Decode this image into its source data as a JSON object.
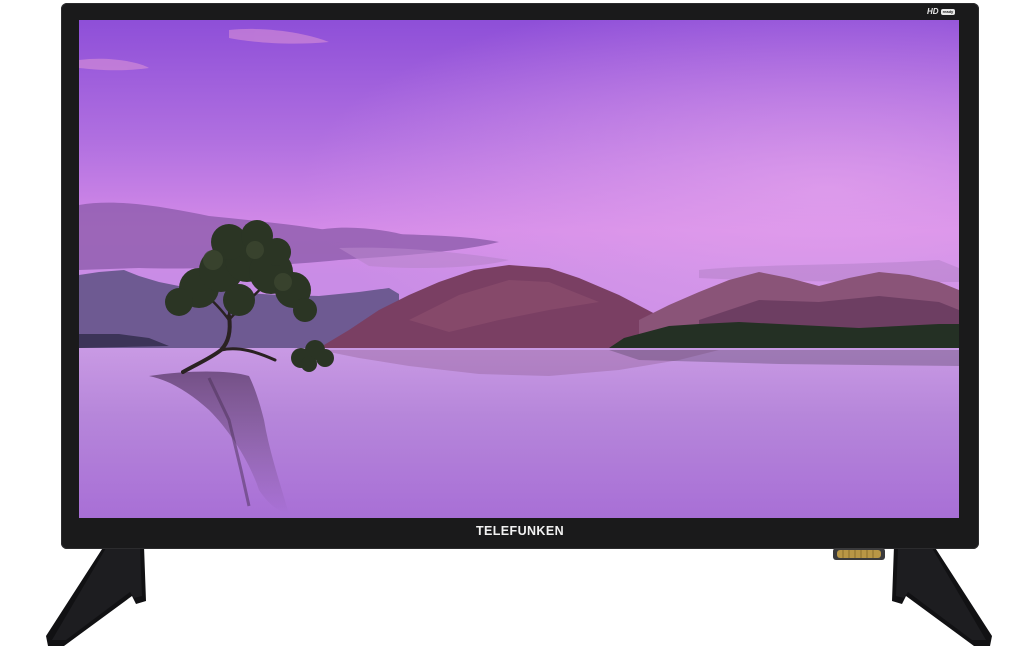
{
  "product": {
    "brand": "TELEFUNKEN",
    "badge_hd": "HD",
    "badge_ready": "ready"
  },
  "colors": {
    "bezel": "#1a1a1b",
    "sky_top": "#8a48d6",
    "sky_bottom": "#d58ee6",
    "water": "#b57dd9",
    "mountains": "#6a3a55",
    "connector_gold": "#b89645"
  },
  "icons": {
    "stand_left": "tv-stand-leg-icon",
    "stand_right": "tv-stand-leg-icon",
    "connector": "antenna-connector-icon"
  }
}
